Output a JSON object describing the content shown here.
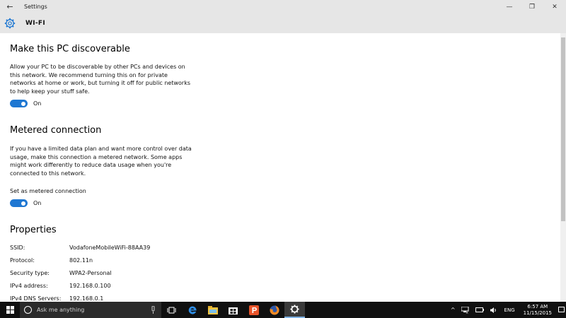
{
  "titlebar": {
    "back_glyph": "←",
    "title": "Settings",
    "minimize_glyph": "—",
    "restore_glyph": "❐",
    "close_glyph": "✕"
  },
  "header": {
    "title": "WI-FI",
    "icon": "gear-icon"
  },
  "discoverable": {
    "heading": "Make this PC discoverable",
    "description": "Allow your PC to be discoverable by other PCs and devices on this network. We recommend turning this on for private networks at home or work, but turning it off for public networks to help keep your stuff safe.",
    "toggle_label": "On"
  },
  "metered": {
    "heading": "Metered connection",
    "description": "If you have a limited data plan and want more control over data usage, make this connection a metered network. Some apps might work differently to reduce data usage when you're connected to this network.",
    "setting_label": "Set as metered connection",
    "toggle_label": "On"
  },
  "properties": {
    "heading": "Properties",
    "rows": [
      {
        "key": "SSID:",
        "value": "VodafoneMobileWiFi-88AA39"
      },
      {
        "key": "Protocol:",
        "value": "802.11n"
      },
      {
        "key": "Security type:",
        "value": "WPA2-Personal"
      },
      {
        "key": "IPv4 address:",
        "value": "192.168.0.100"
      },
      {
        "key": "IPv4 DNS Servers:",
        "value": "192.168.0.1"
      }
    ]
  },
  "taskbar": {
    "search_placeholder": "Ask me anything",
    "tray": {
      "chevron_glyph": "^",
      "lang": "ENG",
      "time": "6:57 AM",
      "date": "11/15/2015"
    }
  },
  "colors": {
    "accent": "#1e77d2",
    "header_bg": "#e6e6e6",
    "taskbar_bg": "#101010"
  }
}
